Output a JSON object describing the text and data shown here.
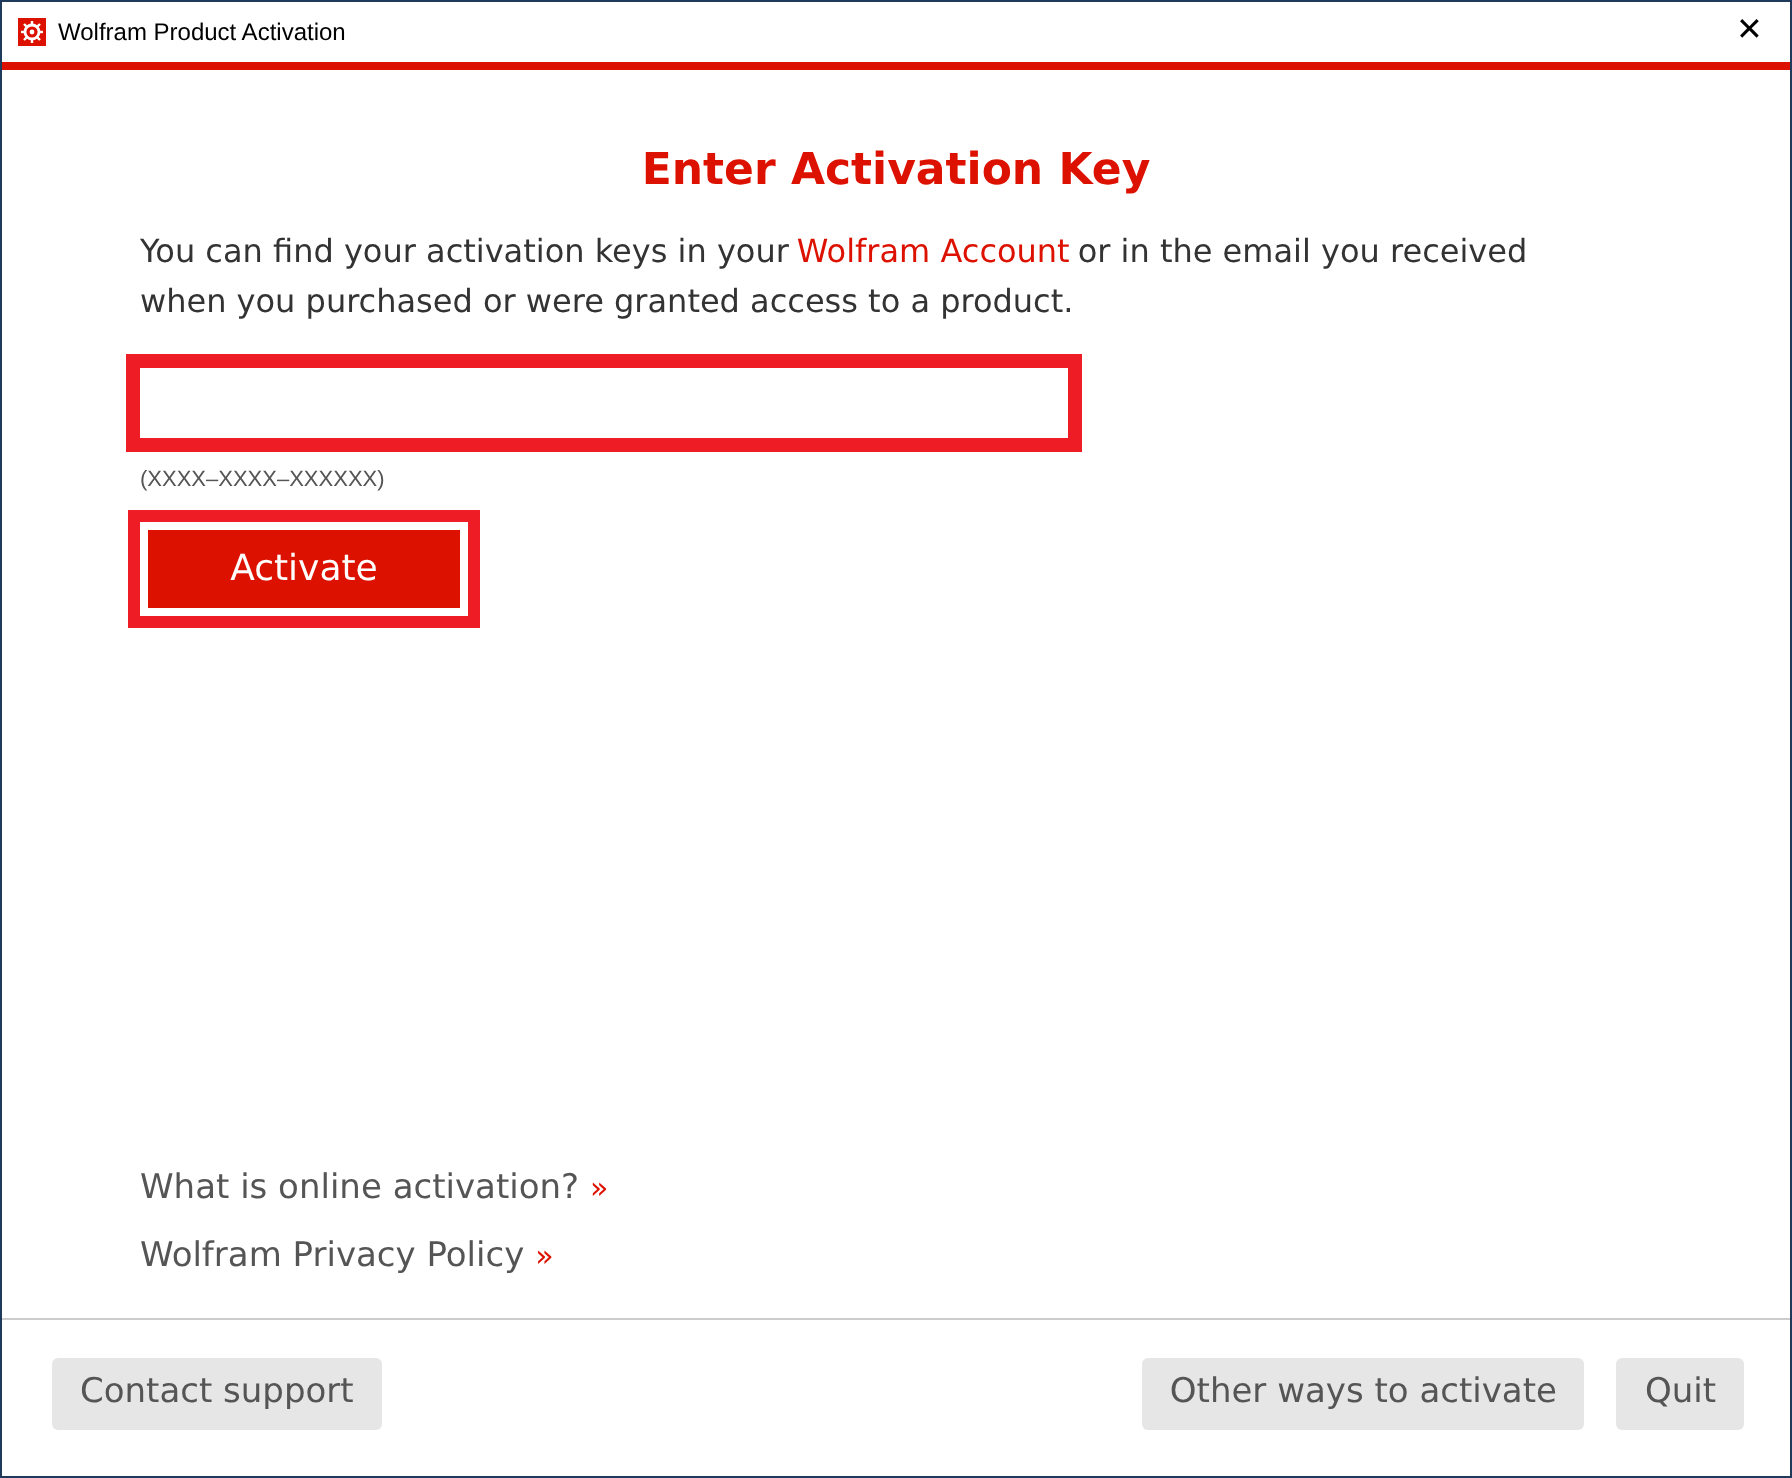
{
  "window": {
    "title": "Wolfram Product Activation",
    "close": "✕"
  },
  "heading": "Enter Activation Key",
  "intro": {
    "before": "You can find your activation keys in your",
    "link": "Wolfram Account",
    "after": "or in the email you received when you purchased or were granted access to a product."
  },
  "key_field": {
    "focused": true,
    "hint": "(XXXX–XXXX–XXXXXX)"
  },
  "activate_button": {
    "label": "Activate",
    "highlighted": true
  },
  "links": [
    {
      "label": "What is online activation?",
      "marker": "»"
    },
    {
      "label": "Wolfram Privacy Policy",
      "marker": "»"
    }
  ],
  "footer": {
    "left": [
      "Contact support"
    ],
    "right": [
      "Other ways to activate",
      "Quit"
    ]
  }
}
